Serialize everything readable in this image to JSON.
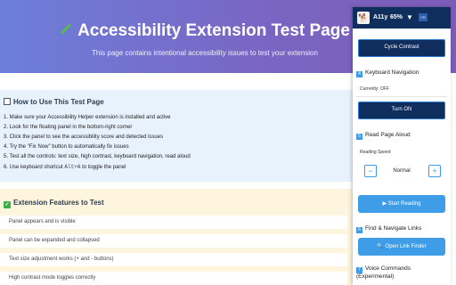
{
  "hero": {
    "title": "Accessibility Extension Test Page",
    "subtitle": "This page contains intentional accessibility issues to test your extension"
  },
  "howto": {
    "title": "How to Use This Test Page",
    "steps": [
      "1. Make sure your Accessibility Helper extension is installed and active",
      "2. Look for the floating panel in the bottom-right corner",
      "3. Click the panel to see the accessibility score and detected issues",
      "4. Try the \"Fix Now\" button to automatically fix issues",
      "5. Test all the controls: text size, high contrast, keyboard navigation, read aloud"
    ],
    "step6_prefix": "6. Use keyboard shortcut",
    "step6_kbd": "Alt+A",
    "step6_suffix": "to toggle the panel"
  },
  "features": {
    "title": "Extension Features to Test",
    "items": [
      "Panel appears and is visible",
      "Panel can be expanded and collapsed",
      "Text size adjustment works (+ and - buttons)",
      "High contrast mode toggles correctly"
    ]
  },
  "panel": {
    "logo_icon": "dog-icon",
    "brand": "A11y",
    "score": "65%",
    "chevron": "▼",
    "badge": "FR",
    "cycle_contrast": "Cycle Contrast",
    "keyboard": {
      "number": "4",
      "title": "Keyboard Navigation",
      "status_label": "Currently:",
      "status_value": "OFF",
      "button": "Turn ON"
    },
    "read_aloud": {
      "number": "5",
      "title": "Read Page Aloud",
      "speed_label": "Reading Speed",
      "minus": "−",
      "speed_value": "Normal",
      "plus": "+",
      "start_button": "▶ Start Reading"
    },
    "find_links": {
      "number": "6",
      "title": "Find & Navigate Links",
      "button": "🔍 Open Link Finder"
    },
    "voice": {
      "number": "7",
      "title": "Voice Commands",
      "title_line2": "(Experimental)"
    },
    "colors": {
      "header": "#0f2e5e",
      "accent": "#3f9ce6"
    }
  }
}
